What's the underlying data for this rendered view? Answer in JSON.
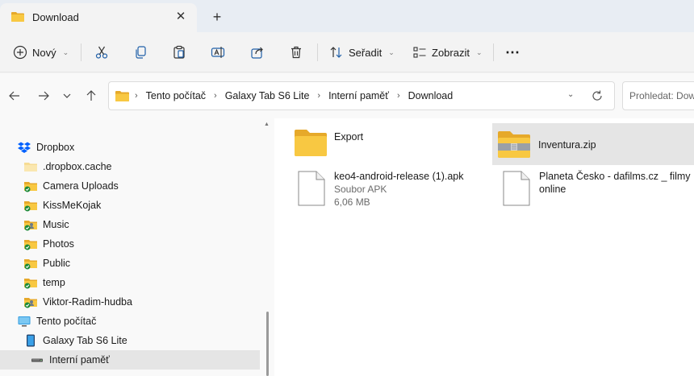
{
  "tab": {
    "title": "Download",
    "close": "✕",
    "new": "+"
  },
  "commands": {
    "new_label": "Nový",
    "sort_label": "Seřadit",
    "view_label": "Zobrazit",
    "more": "⋯"
  },
  "address": {
    "crumbs": [
      "Tento počítač",
      "Galaxy Tab S6 Lite",
      "Interní paměť",
      "Download"
    ],
    "search_placeholder": "Prohledat: Download"
  },
  "sidebar": {
    "items": [
      {
        "label": "Dropbox",
        "icon": "dropbox-icon"
      },
      {
        "label": ".dropbox.cache",
        "icon": "folder-icon"
      },
      {
        "label": "Camera Uploads",
        "icon": "folder-synced-icon"
      },
      {
        "label": "KissMeKojak",
        "icon": "folder-synced-icon"
      },
      {
        "label": "Music",
        "icon": "folder-shared-icon"
      },
      {
        "label": "Photos",
        "icon": "folder-synced-icon"
      },
      {
        "label": "Public",
        "icon": "folder-synced-icon"
      },
      {
        "label": "temp",
        "icon": "folder-synced-icon"
      },
      {
        "label": "Viktor-Radim-hudba",
        "icon": "folder-shared-icon"
      },
      {
        "label": "Tento počítač",
        "icon": "computer-icon"
      },
      {
        "label": "Galaxy Tab S6 Lite",
        "icon": "tablet-icon"
      },
      {
        "label": "Interní paměť",
        "icon": "drive-icon"
      }
    ]
  },
  "files": [
    {
      "name": "Export",
      "type": "folder"
    },
    {
      "name": "Inventura.zip",
      "type": "zip"
    },
    {
      "name": "keo4-android-release (1).apk",
      "sub1": "Soubor APK",
      "sub2": "6,06 MB",
      "type": "file"
    },
    {
      "name": "Planeta Česko - dafilms.cz _ filmy",
      "name2": "online",
      "type": "file"
    }
  ],
  "colors": {
    "folder": "#f8c842",
    "folder_dark": "#e6a92a",
    "accent": "#0067c0",
    "selected": "#e5e5e5",
    "dropbox": "#0061fe",
    "sync": "#1d8a3a"
  }
}
